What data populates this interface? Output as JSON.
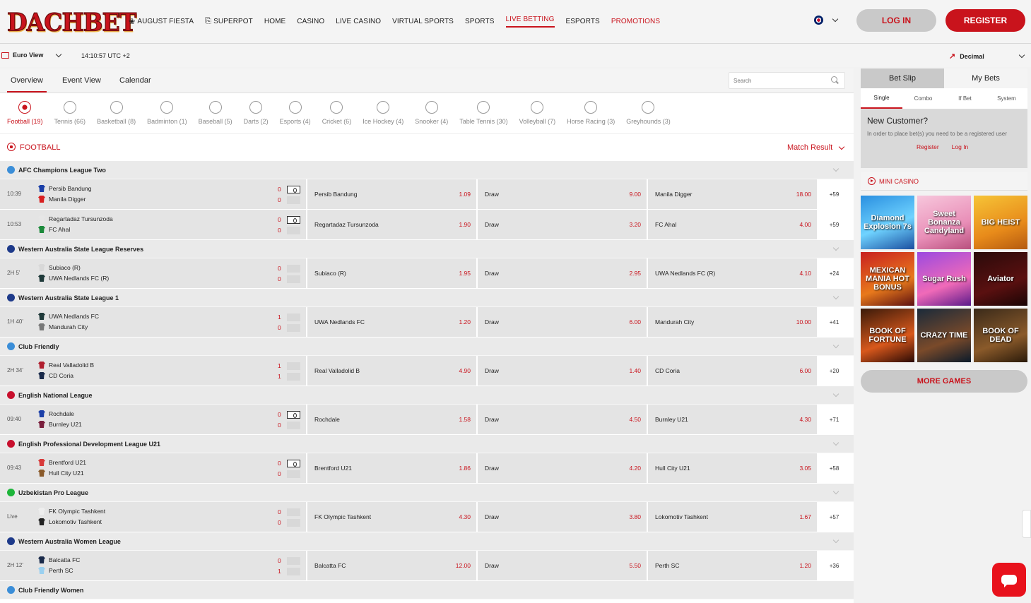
{
  "brand": {
    "logo": "DACHBET"
  },
  "nav": [
    {
      "label": "AUGUST FIESTA",
      "icon": "gift-icon"
    },
    {
      "label": "SUPERPOT",
      "icon": "ticket-icon"
    },
    {
      "label": "HOME"
    },
    {
      "label": "CASINO"
    },
    {
      "label": "LIVE CASINO"
    },
    {
      "label": "VIRTUAL SPORTS"
    },
    {
      "label": "SPORTS"
    },
    {
      "label": "LIVE BETTING",
      "active": true
    },
    {
      "label": "ESPORTS"
    },
    {
      "label": "PROMOTIONS",
      "highlight": true
    }
  ],
  "auth": {
    "login": "LOG IN",
    "register": "REGISTER"
  },
  "subbar": {
    "view": "Euro View",
    "clock": "14:10:57 UTC +2",
    "odds_format": "Decimal"
  },
  "tabs": [
    {
      "label": "Overview",
      "active": true
    },
    {
      "label": "Event View"
    },
    {
      "label": "Calendar"
    }
  ],
  "search": {
    "placeholder": "Search"
  },
  "sports": [
    {
      "label": "Football (19)",
      "active": true
    },
    {
      "label": "Tennis (66)"
    },
    {
      "label": "Basketball (8)"
    },
    {
      "label": "Badminton (1)"
    },
    {
      "label": "Baseball (5)"
    },
    {
      "label": "Darts (2)"
    },
    {
      "label": "Esports (4)"
    },
    {
      "label": "Cricket (6)"
    },
    {
      "label": "Ice Hockey (4)"
    },
    {
      "label": "Snooker (4)"
    },
    {
      "label": "Table Tennis (30)"
    },
    {
      "label": "Volleyball (7)"
    },
    {
      "label": "Horse Racing (3)"
    },
    {
      "label": "Greyhounds (3)"
    }
  ],
  "section": {
    "title": "FOOTBALL",
    "market": "Match Result"
  },
  "leagues": [
    {
      "name": "AFC Champions League Two",
      "flag": "#3b8ed8",
      "matches": [
        {
          "time": "10:39",
          "home": "Persib Bandung",
          "away": "Manila Digger",
          "score_home": "0",
          "score_away": "0",
          "home_color": "#1b3fa8",
          "away_color": "#d81f1f",
          "pitch": true,
          "odds": [
            "1.09",
            "9.00",
            "18.00"
          ],
          "draw": "Draw",
          "more": "+59"
        },
        {
          "time": "10:53",
          "home": "Regartadaz Tursunzoda",
          "away": "FC Ahal",
          "score_home": "0",
          "score_away": "0",
          "home_color": "#e6e6e6",
          "away_color": "#1c8a3b",
          "pitch": true,
          "odds": [
            "1.90",
            "3.20",
            "4.00"
          ],
          "draw": "Draw",
          "more": "+59"
        }
      ]
    },
    {
      "name": "Western Australia State League Reserves",
      "flag": "#1e3a8a",
      "matches": [
        {
          "time": "2H 5'",
          "home": "Subiaco (R)",
          "away": "UWA Nedlands FC (R)",
          "score_home": "0",
          "score_away": "0",
          "home_color": "#d8d8d8",
          "away_color": "#1f3a3a",
          "pitch": false,
          "odds": [
            "1.95",
            "2.95",
            "4.10"
          ],
          "draw": "Draw",
          "more": "+24"
        }
      ]
    },
    {
      "name": "Western Australia State League 1",
      "flag": "#1e3a8a",
      "matches": [
        {
          "time": "1H 40'",
          "home": "UWA Nedlands FC",
          "away": "Mandurah City",
          "score_home": "1",
          "score_away": "0",
          "home_color": "#1f3a3a",
          "away_color": "#777777",
          "pitch": false,
          "odds": [
            "1.20",
            "6.00",
            "10.00"
          ],
          "draw": "Draw",
          "more": "+41"
        }
      ]
    },
    {
      "name": "Club Friendly",
      "flag": "#3b8ed8",
      "matches": [
        {
          "time": "2H 34'",
          "home": "Real Valladolid B",
          "away": "CD Coria",
          "score_home": "1",
          "score_away": "1",
          "home_color": "#b01e2e",
          "away_color": "#1a2a4a",
          "pitch": false,
          "odds": [
            "4.90",
            "1.40",
            "6.00"
          ],
          "draw": "Draw",
          "more": "+20"
        }
      ]
    },
    {
      "name": "English National League",
      "flag": "#c8102e",
      "matches": [
        {
          "time": "09:40",
          "home": "Rochdale",
          "away": "Burnley U21",
          "score_home": "0",
          "score_away": "0",
          "home_color": "#1b3fa8",
          "away_color": "#7a1f3d",
          "pitch": true,
          "odds": [
            "1.58",
            "4.50",
            "4.30"
          ],
          "draw": "Draw",
          "more": "+71"
        }
      ]
    },
    {
      "name": "English Professional Development League U21",
      "flag": "#c8102e",
      "matches": [
        {
          "time": "09:43",
          "home": "Brentford U21",
          "away": "Hull City U21",
          "score_home": "0",
          "score_away": "0",
          "home_color": "#d83a3a",
          "away_color": "#8a5a2a",
          "pitch": true,
          "odds": [
            "1.86",
            "4.20",
            "3.05"
          ],
          "draw": "Draw",
          "more": "+58"
        }
      ]
    },
    {
      "name": "Uzbekistan Pro League",
      "flag": "#1eb53a",
      "matches": [
        {
          "time": "Live",
          "home": "FK Olympic Tashkent",
          "away": "Lokomotiv Tashkent",
          "score_home": "0",
          "score_away": "0",
          "home_color": "#eeeeee",
          "away_color": "#222222",
          "pitch": false,
          "odds": [
            "4.30",
            "3.80",
            "1.67"
          ],
          "draw": "Draw",
          "more": "+57"
        }
      ]
    },
    {
      "name": "Western Australia Women League",
      "flag": "#1e3a8a",
      "matches": [
        {
          "time": "2H 12'",
          "home": "Balcatta FC",
          "away": "Perth SC",
          "score_home": "0",
          "score_away": "1",
          "home_color": "#1a2a4a",
          "away_color": "#9ad0f0",
          "pitch": false,
          "odds": [
            "12.00",
            "5.50",
            "1.20"
          ],
          "draw": "Draw",
          "more": "+36"
        }
      ]
    },
    {
      "name": "Club Friendly Women",
      "flag": "#3b8ed8",
      "matches": []
    }
  ],
  "betslip": {
    "tabs": [
      {
        "label": "Bet Slip",
        "active": true
      },
      {
        "label": "My Bets"
      }
    ],
    "subtabs": [
      {
        "label": "Single",
        "active": true
      },
      {
        "label": "Combo"
      },
      {
        "label": "If Bet"
      },
      {
        "label": "System"
      }
    ],
    "title": "New Customer?",
    "text": "In order to place bet(s) you need to be a registered user",
    "register": "Register",
    "login": "Log In"
  },
  "mini_casino": {
    "title": "MINI CASINO",
    "games": [
      {
        "label": "Diamond Explosion 7s",
        "bg": "linear-gradient(160deg,#2a8fe0,#6fd3ff 55%,#1a4fa0)"
      },
      {
        "label": "Sweet Bonanza Candyland",
        "bg": "linear-gradient(160deg,#f7c7dc,#e98fb8 60%,#b8507e)"
      },
      {
        "label": "BIG HEIST",
        "bg": "linear-gradient(160deg,#f6c437,#e88b1a 60%,#b45a10)"
      },
      {
        "label": "MEXICAN MANIA HOT BONUS",
        "bg": "linear-gradient(160deg,#c82020,#e8791c 60%,#5c1010)"
      },
      {
        "label": "Sugar Rush",
        "bg": "linear-gradient(160deg,#9b4ae0,#f06ab8 60%,#5a1a8a)"
      },
      {
        "label": "Aviator",
        "bg": "linear-gradient(160deg,#2a0a0a,#5a1010 60%,#1a0505)"
      },
      {
        "label": "BOOK OF FORTUNE",
        "bg": "linear-gradient(160deg,#3a1a0a,#d8581c 60%,#2a0a05)"
      },
      {
        "label": "CRAZY TIME",
        "bg": "linear-gradient(160deg,#1a2a3a,#7a4a2a 60%,#0a1a2a)"
      },
      {
        "label": "BOOK OF DEAD",
        "bg": "linear-gradient(160deg,#3a2a1a,#8a5a2a 60%,#2a1a0a)"
      }
    ],
    "more": "MORE GAMES"
  }
}
